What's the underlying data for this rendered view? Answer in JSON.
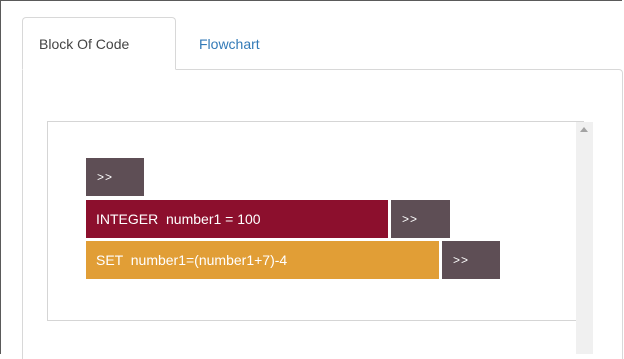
{
  "tabs": [
    {
      "label": "Block Of Code",
      "active": true
    },
    {
      "label": "Flowchart",
      "active": false
    }
  ],
  "code_blocks": {
    "insert_label": ">>",
    "statements": [
      {
        "type": "INTEGER",
        "text": "INTEGER  number1 = 100",
        "color": "#8c0f2d"
      },
      {
        "type": "SET",
        "text": "SET  number1=(number1+7)-4",
        "color": "#e19e36"
      }
    ],
    "insert_button_color": "#5e4e55"
  },
  "colors": {
    "tab_link": "#337ab7",
    "scrollbar_track": "#f0f0f0"
  }
}
